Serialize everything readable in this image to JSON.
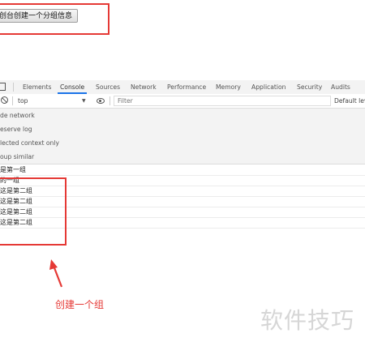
{
  "page": {
    "button_label": "创台创建一个分组信息"
  },
  "devtools": {
    "tabs": [
      "Elements",
      "Console",
      "Sources",
      "Network",
      "Performance",
      "Memory",
      "Application",
      "Security",
      "Audits"
    ],
    "active_tab": "Console",
    "context": "top",
    "filter_placeholder": "Filter",
    "levels_label": "Default leve",
    "settings": [
      "de network",
      "eserve log",
      "lected context only",
      "oup similar"
    ],
    "console_lines": [
      "是第一组",
      "的一组",
      "这是第二组",
      "这是第二组",
      "这是第二组",
      "这是第二组"
    ]
  },
  "annotation": {
    "text": "创建一个组"
  },
  "watermark": {
    "text": "软件技巧"
  },
  "colors": {
    "annotation": "#e53935",
    "active_tab_underline": "#1a73e8"
  }
}
